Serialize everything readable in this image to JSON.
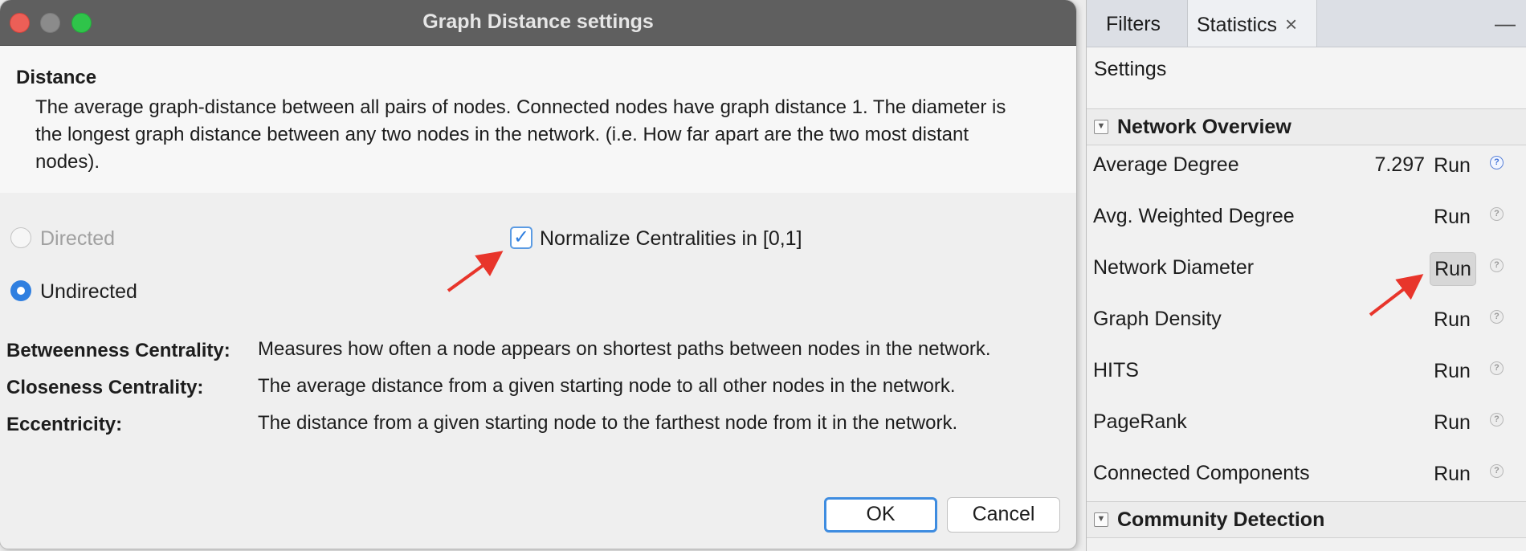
{
  "dialog": {
    "title": "Graph Distance settings",
    "description_heading": "Distance",
    "description_text": "The average graph-distance between all pairs of nodes. Connected nodes have graph distance 1. The diameter is the longest graph distance between any two nodes in the network. (i.e.  How far apart are the two most distant nodes).",
    "options": {
      "directed_label": "Directed",
      "directed_selected": false,
      "directed_enabled": false,
      "undirected_label": "Undirected",
      "undirected_selected": true,
      "normalize_label": "Normalize Centralities in [0,1]",
      "normalize_checked": true
    },
    "definitions": [
      {
        "term": "Betweenness Centrality:",
        "text": "Measures how often a node appears on shortest paths between nodes in the network."
      },
      {
        "term": "Closeness Centrality:",
        "text": "The average distance from a given starting node to all other nodes in the network."
      },
      {
        "term": "Eccentricity:",
        "text": "The distance from a given starting node to the farthest node from it in the network."
      }
    ],
    "ok_label": "OK",
    "cancel_label": "Cancel"
  },
  "panel": {
    "tabs": [
      {
        "label": "Filters",
        "active": false
      },
      {
        "label": "Statistics",
        "active": true,
        "close_glyph": "×"
      }
    ],
    "minimize_glyph": "—",
    "settings_label": "Settings",
    "network_overview": {
      "title": "Network Overview",
      "rows": [
        {
          "name": "Average Degree",
          "value": "7.297",
          "run_label": "Run",
          "help_glyph": "?"
        },
        {
          "name": "Avg. Weighted Degree",
          "value": "",
          "run_label": "Run",
          "help_glyph": "?"
        },
        {
          "name": "Network Diameter",
          "value": "",
          "run_label": "Run",
          "help_glyph": "?"
        },
        {
          "name": "Graph Density",
          "value": "",
          "run_label": "Run",
          "help_glyph": "?"
        },
        {
          "name": "HITS",
          "value": "",
          "run_label": "Run",
          "help_glyph": "?"
        },
        {
          "name": "PageRank",
          "value": "",
          "run_label": "Run",
          "help_glyph": "?"
        },
        {
          "name": "Connected Components",
          "value": "",
          "run_label": "Run",
          "help_glyph": "?"
        }
      ]
    },
    "community_detection": {
      "title": "Community Detection"
    }
  },
  "colors": {
    "accent": "#2f7fe0",
    "annotation_arrow": "#e8352b",
    "titlebar": "#5f5f5f"
  }
}
